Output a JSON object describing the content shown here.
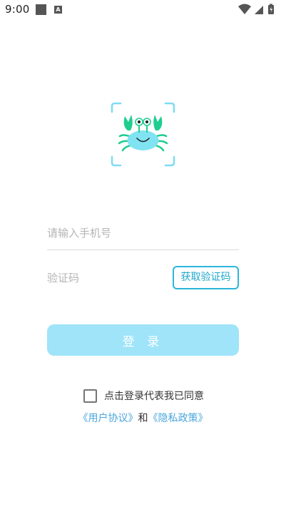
{
  "status_bar": {
    "time": "9:00",
    "left_icons": [
      "notification-square-icon",
      "a-badge-icon"
    ],
    "right_icons": [
      "wifi-icon",
      "signal-icon",
      "battery-icon"
    ]
  },
  "logo": {
    "icon": "crab-mascot-icon",
    "colors": {
      "body": "#7fe3f2",
      "claws": "#1fce8f",
      "frame": "#7fdcf0"
    }
  },
  "form": {
    "phone_placeholder": "请输入手机号",
    "code_placeholder": "验证码",
    "get_code_label": "获取验证码",
    "login_label": "登 录"
  },
  "agreement": {
    "text": "点击登录代表我已同意",
    "user_agreement": "《用户协议》",
    "and": "和",
    "privacy_policy": "《隐私政策》",
    "checked": false
  },
  "colors": {
    "accent": "#2bb6d9",
    "login_button": "#9fe4f9",
    "link": "#4aa6dd"
  }
}
